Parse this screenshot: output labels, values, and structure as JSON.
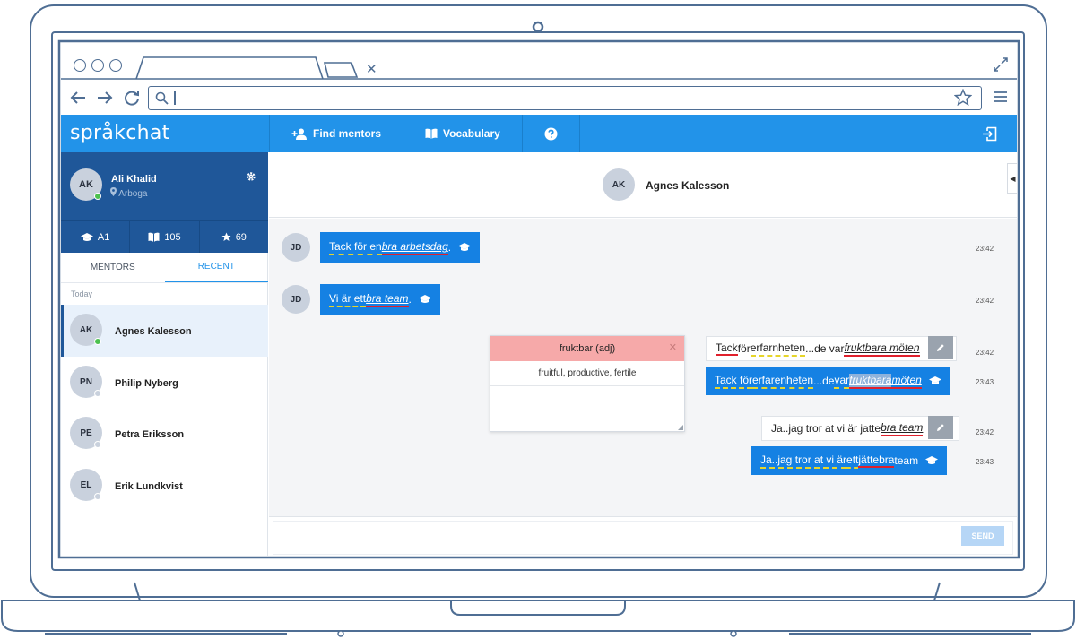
{
  "app": {
    "brand": "språkchat"
  },
  "topnav": {
    "find_mentors": "Find mentors",
    "vocabulary": "Vocabulary",
    "help_icon": "question-circle-icon",
    "logout_icon": "sign-out-icon"
  },
  "profile": {
    "initials": "AK",
    "name": "Ali Khalid",
    "location": "Arboga",
    "online": true,
    "stats": {
      "level": "A1",
      "words": "105",
      "stars": "69"
    }
  },
  "sidebar": {
    "tabs": [
      "MENTORS",
      "RECENT"
    ],
    "active_tab": "RECENT",
    "section": "Today",
    "contacts": [
      {
        "initials": "AK",
        "name": "Agnes Kalesson",
        "online": true,
        "selected": true
      },
      {
        "initials": "PN",
        "name": "Philip Nyberg",
        "online": false
      },
      {
        "initials": "PE",
        "name": "Petra Eriksson",
        "online": false
      },
      {
        "initials": "EL",
        "name": "Erik Lundkvist",
        "online": false
      }
    ]
  },
  "chat": {
    "partner_initials": "AK",
    "partner_name": "Agnes Kalesson",
    "messages": [
      {
        "sender": "JD",
        "text_plain": "Tack för en ",
        "text_term": "bra arbetsdag",
        "text_end": ".",
        "time": "23:42"
      },
      {
        "sender": "JD",
        "text_plain": "Vi är ett ",
        "text_term": "bra team",
        "text_end": ".",
        "time": "23:42"
      },
      {
        "original": "Tack för erfarnheten...de var fruktbara möten",
        "corrected": "Tack för erfarenheten...de var fruktbara möten",
        "time_original": "23:42",
        "time_corrected": "23:43"
      },
      {
        "original": "Ja..jag tror at vi är jatte bra team",
        "corrected": "Ja..jag tror at vi är ett jättebra team",
        "time_original": "23:42",
        "time_corrected": "23:43"
      }
    ],
    "vocab_popup": {
      "word": "fruktbar (adj)",
      "meaning": "fruitful, productive, fertile"
    },
    "send_label": "SEND",
    "colors": {
      "primary": "#2293e9",
      "dark": "#1f5799",
      "bubble": "#1581e3",
      "popup_header": "#f6a9a9"
    }
  },
  "m3": {
    "o_a": "Tack",
    "o_b": " för ",
    "o_c": "erfarnheten",
    "o_d": "...de var ",
    "o_e": "fruktbara möten",
    "c_a": "Tack för ",
    "c_b": "erfarenheten",
    "c_c": "...de ",
    "c_d": "var",
    "c_e": " ",
    "c_f": "fruktbara",
    "c_g": " ",
    "c_h": "möten"
  },
  "m4": {
    "o_a": "Ja..jag tror at vi är jatte ",
    "o_b": "bra team",
    "c_a": "Ja..jag tror at vi är ",
    "c_b": "ett",
    "c_c": " ",
    "c_d": "jättebra",
    "c_e": " team"
  }
}
